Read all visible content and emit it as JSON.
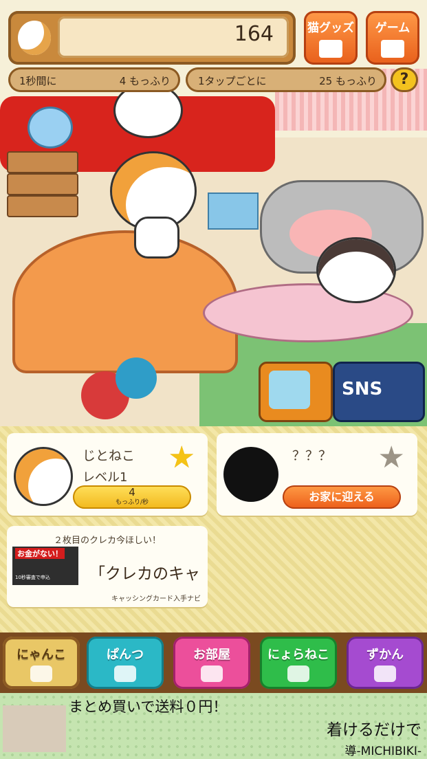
{
  "hud": {
    "counter_value": "164",
    "goods_button_label": "猫グッズ",
    "game_button_label": "ゲーム",
    "per_second_label": "1秒間に",
    "per_second_value": "4 もっふり",
    "per_tap_label": "1タップごとに",
    "per_tap_value": "25 もっふり",
    "help_label": "?"
  },
  "scene_buttons": {
    "sns_label": "SNS"
  },
  "cats": [
    {
      "name": "じとねこ",
      "level": "レベル1",
      "rate_value": "4",
      "rate_unit": "もっふり/秒",
      "status": "owned"
    },
    {
      "name": "？？？",
      "button_label": "お家に迎える",
      "status": "locked"
    }
  ],
  "ad_card": {
    "top_text": "２枚目のクレカ今ほしい！",
    "image_text": "お金がない！",
    "image_sub": "10秒審査で申込",
    "main_text": "「クレカのキャ",
    "bottom_text": "キャッシングカード入手ナビ"
  },
  "nav": [
    {
      "label": "にゃんこ",
      "active": true
    },
    {
      "label": "ぱんつ",
      "active": false
    },
    {
      "label": "お部屋",
      "active": false
    },
    {
      "label": "にょらねこ",
      "active": false
    },
    {
      "label": "ずかん",
      "active": false
    }
  ],
  "bottom_ad": {
    "top_text": "まとめ買いで送料０円！",
    "middle_text": "着けるだけで",
    "brand": "導-MICHIBIKI-"
  },
  "colors": {
    "accent_orange": "#e85f1b",
    "gold_star": "#f5c316",
    "wood": "#8b5a23"
  }
}
